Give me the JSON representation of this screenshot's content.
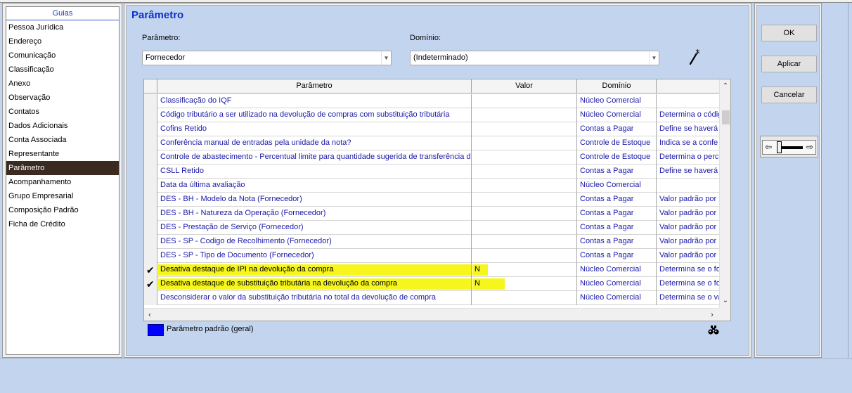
{
  "sidebar": {
    "header": "Guias",
    "items": [
      {
        "label": "Pessoa Jurídica"
      },
      {
        "label": "Endereço"
      },
      {
        "label": "Comunicação"
      },
      {
        "label": "Classificação"
      },
      {
        "label": "Anexo"
      },
      {
        "label": "Observação"
      },
      {
        "label": "Contatos"
      },
      {
        "label": "Dados Adicionais"
      },
      {
        "label": "Conta Associada"
      },
      {
        "label": "Representante"
      },
      {
        "label": "Parâmetro",
        "active": true
      },
      {
        "label": "Acompanhamento"
      },
      {
        "label": "Grupo Empresarial"
      },
      {
        "label": "Composição Padrão"
      },
      {
        "label": "Ficha de Crédito"
      }
    ]
  },
  "main": {
    "title": "Parâmetro",
    "param_filter": {
      "label": "Parâmetro:",
      "value": "Fornecedor"
    },
    "domain_filter": {
      "label": "Domínio:",
      "value": "(Indeterminado)"
    }
  },
  "grid": {
    "columns": [
      "Parâmetro",
      "Valor",
      "Domínio",
      ""
    ],
    "rows": [
      {
        "param": "Classificação do IQF",
        "value": "",
        "domain": "Núcleo Comercial",
        "desc": "",
        "checked": false
      },
      {
        "param": "Código tributário a ser utilizado na devolução de compras com substituição tributária",
        "value": "",
        "domain": "Núcleo Comercial",
        "desc": "Determina o códig",
        "checked": false
      },
      {
        "param": "Cofins Retido",
        "value": "",
        "domain": "Contas a Pagar",
        "desc": "Define se haverá",
        "checked": false
      },
      {
        "param": "Conferência manual de entradas pela unidade da nota?",
        "value": "",
        "domain": "Controle de Estoque",
        "desc": "Indica se a confe",
        "checked": false
      },
      {
        "param": "Controle de abastecimento - Percentual limite para quantidade sugerida de transferência do",
        "value": "",
        "domain": "Controle de Estoque",
        "desc": "Determina o perce",
        "checked": false
      },
      {
        "param": "CSLL Retido",
        "value": "",
        "domain": "Contas a Pagar",
        "desc": "Define se haverá",
        "checked": false
      },
      {
        "param": "Data da última avaliação",
        "value": "",
        "domain": "Núcleo Comercial",
        "desc": "",
        "checked": false
      },
      {
        "param": "DES - BH - Modelo da Nota (Fornecedor)",
        "value": "",
        "domain": "Contas a Pagar",
        "desc": "Valor padrão por",
        "checked": false
      },
      {
        "param": "DES - BH - Natureza da Operação (Fornecedor)",
        "value": "",
        "domain": "Contas a Pagar",
        "desc": "Valor padrão por",
        "checked": false
      },
      {
        "param": "DES - Prestação de Serviço (Fornecedor)",
        "value": "",
        "domain": "Contas a Pagar",
        "desc": "Valor padrão por",
        "checked": false
      },
      {
        "param": "DES - SP - Codigo de Recolhimento (Fornecedor)",
        "value": "",
        "domain": "Contas a Pagar",
        "desc": "Valor padrão por",
        "checked": false
      },
      {
        "param": "DES - SP - Tipo de Documento (Fornecedor)",
        "value": "",
        "domain": "Contas a Pagar",
        "desc": "Valor padrão por",
        "checked": false
      },
      {
        "param": "Desativa destaque de IPI na devolução da compra",
        "value": "N",
        "domain": "Núcleo Comercial",
        "desc": "Determina se o fo",
        "checked": true
      },
      {
        "param": "Desativa destaque de substituição tributária na devolução da compra",
        "value": "N",
        "domain": "Núcleo Comercial",
        "desc": "Determina se o fo",
        "checked": true
      },
      {
        "param": "Desconsiderar o valor da substituição tributária no total da devolução de compra",
        "value": "",
        "domain": "Núcleo Comercial",
        "desc": "Determina se o va",
        "checked": false
      }
    ]
  },
  "legend": {
    "label": "Parâmetro padrão (geral)",
    "color": "#0000ff"
  },
  "buttons": {
    "ok": "OK",
    "apply": "Aplicar",
    "cancel": "Cancelar"
  },
  "icons": {
    "wand": "magic-wand-icon",
    "search": "binoculars-icon"
  },
  "colors": {
    "background": "#c3d5ee",
    "title": "#1030c8",
    "grid_text": "#1a1aa8",
    "highlight": "#f6f61c",
    "active_tab": "#3b2a1f"
  }
}
